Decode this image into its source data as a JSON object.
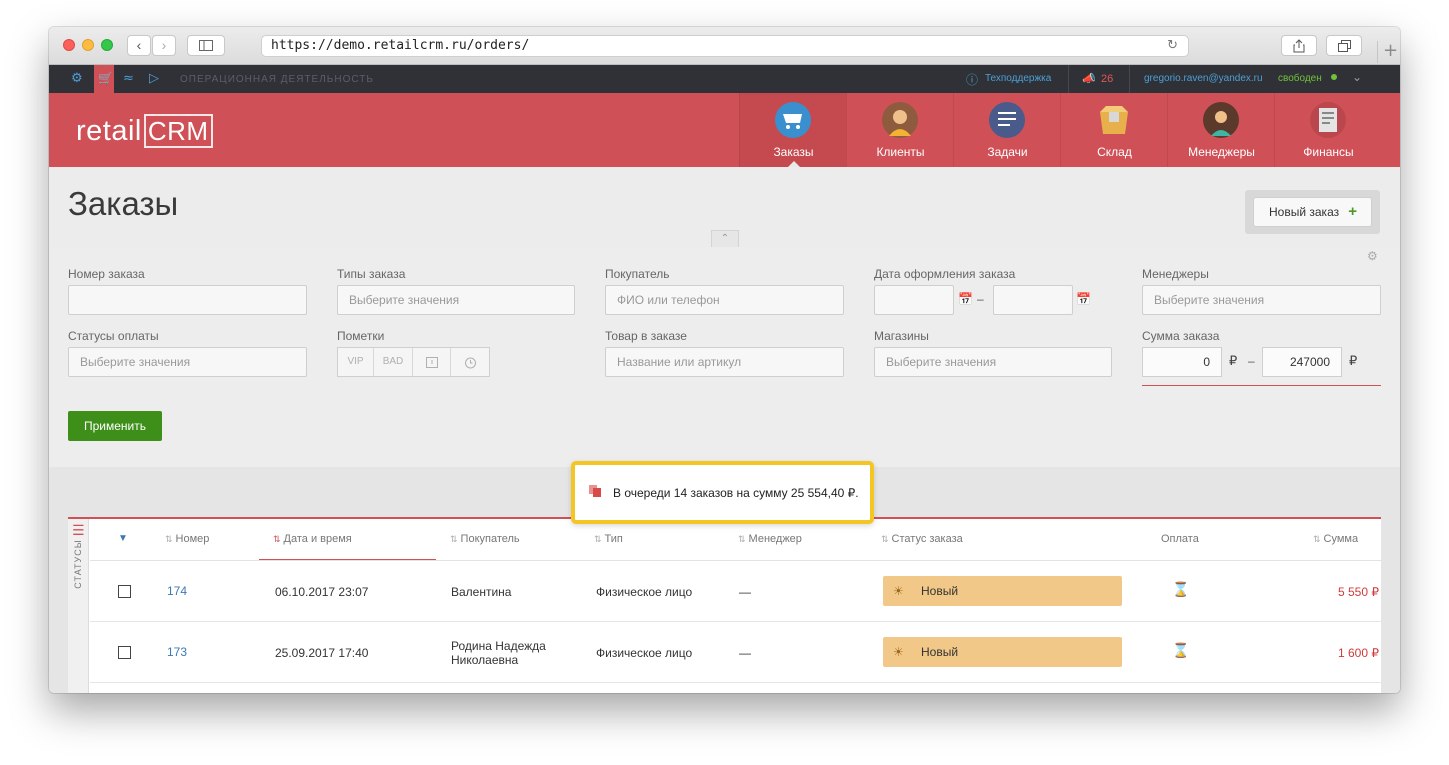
{
  "browser": {
    "url": "https://demo.retailcrm.ru/orders/",
    "reload_icon": "reload-icon",
    "new_tab_label": "+"
  },
  "topbar": {
    "section_title": "ОПЕРАЦИОННАЯ ДЕЯТЕЛЬНОСТЬ",
    "support_label": "Техподдержка",
    "notifications_count": "26",
    "user_email": "gregorio.raven@yandex.ru",
    "user_status": "свободен"
  },
  "header": {
    "logo_text": "retail",
    "logo_crm": "CRM",
    "modules": [
      {
        "label": "Заказы",
        "icon": "cart-icon",
        "color": "#3a8fce"
      },
      {
        "label": "Клиенты",
        "icon": "person-icon",
        "color": "#f2b233"
      },
      {
        "label": "Задачи",
        "icon": "tasks-icon",
        "color": "#4a5a8a"
      },
      {
        "label": "Склад",
        "icon": "box-icon",
        "color": "#e8b04a"
      },
      {
        "label": "Менеджеры",
        "icon": "manager-icon",
        "color": "#3fb5a5"
      },
      {
        "label": "Финансы",
        "icon": "finance-icon",
        "color": "#e4e4e4"
      }
    ]
  },
  "page": {
    "title": "Заказы",
    "new_order_label": "Новый заказ",
    "new_order_plus": "+"
  },
  "filters": {
    "order_number_label": "Номер заказа",
    "order_number_value": "",
    "order_types_label": "Типы заказа",
    "order_types_placeholder": "Выберите значения",
    "customer_label": "Покупатель",
    "customer_placeholder": "ФИО или телефон",
    "date_label": "Дата оформления заказа",
    "date_dash": "–",
    "managers_label": "Менеджеры",
    "managers_placeholder": "Выберите значения",
    "payment_status_label": "Статусы оплаты",
    "payment_status_placeholder": "Выберите значения",
    "marks_label": "Пометки",
    "marks": [
      "VIP",
      "BAD",
      "!",
      "⏰"
    ],
    "product_label": "Товар в заказе",
    "product_placeholder": "Название или артикул",
    "shops_label": "Магазины",
    "shops_placeholder": "Выберите значения",
    "sum_label": "Сумма заказа",
    "sum_from": "0",
    "sum_to": "247000",
    "currency": "₽",
    "sum_dash": "–",
    "apply_label": "Применить"
  },
  "notice": {
    "text": "В очереди 14 заказов на сумму 25 554,40 ₽."
  },
  "table": {
    "side_label": "СТАТУСЫ",
    "headers": {
      "number": "Номер",
      "datetime": "Дата и время",
      "customer": "Покупатель",
      "type": "Тип",
      "manager": "Менеджер",
      "status": "Статус заказа",
      "payment": "Оплата",
      "sum": "Сумма"
    },
    "rows": [
      {
        "number": "174",
        "datetime": "06.10.2017 23:07",
        "customer": "Валентина",
        "type": "Физическое лицо",
        "manager": "—",
        "status": "Новый",
        "sum": "5 550 ₽"
      },
      {
        "number": "173",
        "datetime": "25.09.2017 17:40",
        "customer": "Родина Надежда Николаевна",
        "type": "Физическое лицо",
        "manager": "—",
        "status": "Новый",
        "sum": "1 600 ₽"
      }
    ]
  }
}
